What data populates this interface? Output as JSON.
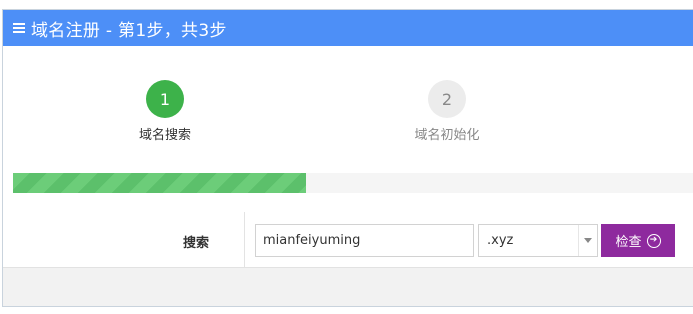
{
  "header": {
    "title": "域名注册 - 第1步，共3步",
    "menu_icon": "hamburger-icon",
    "background_color": "#4d8ff7"
  },
  "steps": [
    {
      "number": "1",
      "label": "域名搜索",
      "status": "active"
    },
    {
      "number": "2",
      "label": "域名初始化",
      "status": "inactive"
    }
  ],
  "progress": {
    "value_fraction": 0.43,
    "color": "#5cc06b"
  },
  "form": {
    "search_label": "搜索",
    "search_value": "mianfeiyuming",
    "tld_selected": ".xyz",
    "check_button_label": "检查",
    "check_button_icon": "arrow-circle-right-icon",
    "check_button_color": "#8e2a9e"
  }
}
